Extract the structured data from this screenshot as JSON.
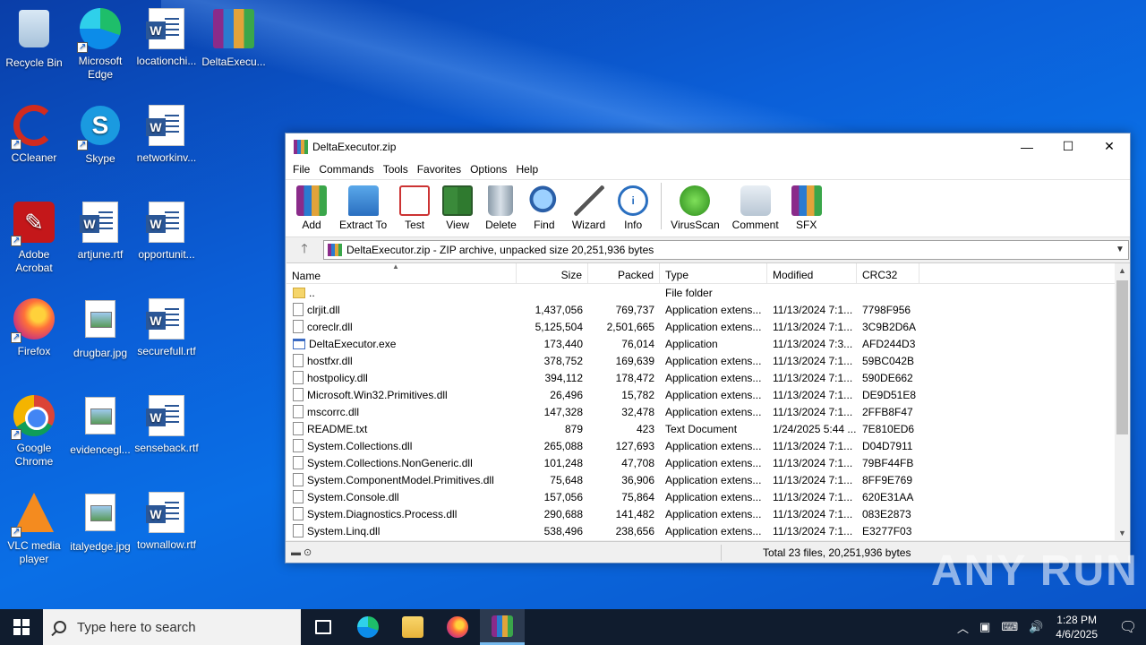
{
  "desktop": {
    "icons": [
      {
        "label": "Recycle Bin",
        "icon": "recycle-bin-icon"
      },
      {
        "label": "Microsoft Edge",
        "icon": "edge-icon"
      },
      {
        "label": "locationchi...",
        "icon": "word-doc-icon"
      },
      {
        "label": "DeltaExecu...",
        "icon": "winrar-icon"
      },
      {
        "label": "CCleaner",
        "icon": "ccleaner-icon"
      },
      {
        "label": "Skype",
        "icon": "skype-icon"
      },
      {
        "label": "networkinv...",
        "icon": "word-doc-icon"
      },
      {
        "label": "Adobe Acrobat",
        "icon": "acrobat-icon"
      },
      {
        "label": "artjune.rtf",
        "icon": "word-doc-icon"
      },
      {
        "label": "opportunit...",
        "icon": "word-doc-icon"
      },
      {
        "label": "Firefox",
        "icon": "firefox-icon"
      },
      {
        "label": "drugbar.jpg",
        "icon": "image-file-icon"
      },
      {
        "label": "securefull.rtf",
        "icon": "word-doc-icon"
      },
      {
        "label": "Google Chrome",
        "icon": "chrome-icon"
      },
      {
        "label": "evidencegl...",
        "icon": "image-file-icon"
      },
      {
        "label": "senseback.rtf",
        "icon": "word-doc-icon"
      },
      {
        "label": "VLC media player",
        "icon": "vlc-icon"
      },
      {
        "label": "italyedge.jpg",
        "icon": "image-file-icon"
      },
      {
        "label": "townallow.rtf",
        "icon": "word-doc-icon"
      }
    ]
  },
  "window": {
    "title": "DeltaExecutor.zip",
    "controls": {
      "minimize": "—",
      "maximize": "☐",
      "close": "✕"
    },
    "menu": [
      "File",
      "Commands",
      "Tools",
      "Favorites",
      "Options",
      "Help"
    ],
    "toolbar": [
      "Add",
      "Extract To",
      "Test",
      "View",
      "Delete",
      "Find",
      "Wizard",
      "Info",
      "VirusScan",
      "Comment",
      "SFX"
    ],
    "address": "DeltaExecutor.zip - ZIP archive, unpacked size 20,251,936 bytes",
    "columns": {
      "name": "Name",
      "size": "Size",
      "packed": "Packed",
      "type": "Type",
      "modified": "Modified",
      "crc": "CRC32"
    },
    "files": [
      {
        "name": "..",
        "size": "",
        "packed": "",
        "type": "File folder",
        "modified": "",
        "crc": "",
        "kind": "folder"
      },
      {
        "name": "clrjit.dll",
        "size": "1,437,056",
        "packed": "769,737",
        "type": "Application extens...",
        "modified": "11/13/2024 7:1...",
        "crc": "7798F956",
        "kind": "file"
      },
      {
        "name": "coreclr.dll",
        "size": "5,125,504",
        "packed": "2,501,665",
        "type": "Application extens...",
        "modified": "11/13/2024 7:1...",
        "crc": "3C9B2D6A",
        "kind": "file"
      },
      {
        "name": "DeltaExecutor.exe",
        "size": "173,440",
        "packed": "76,014",
        "type": "Application",
        "modified": "11/13/2024 7:3...",
        "crc": "AFD244D3",
        "kind": "exe"
      },
      {
        "name": "hostfxr.dll",
        "size": "378,752",
        "packed": "169,639",
        "type": "Application extens...",
        "modified": "11/13/2024 7:1...",
        "crc": "59BC042B",
        "kind": "file"
      },
      {
        "name": "hostpolicy.dll",
        "size": "394,112",
        "packed": "178,472",
        "type": "Application extens...",
        "modified": "11/13/2024 7:1...",
        "crc": "590DE662",
        "kind": "file"
      },
      {
        "name": "Microsoft.Win32.Primitives.dll",
        "size": "26,496",
        "packed": "15,782",
        "type": "Application extens...",
        "modified": "11/13/2024 7:1...",
        "crc": "DE9D51E8",
        "kind": "file"
      },
      {
        "name": "mscorrc.dll",
        "size": "147,328",
        "packed": "32,478",
        "type": "Application extens...",
        "modified": "11/13/2024 7:1...",
        "crc": "2FFB8F47",
        "kind": "file"
      },
      {
        "name": "README.txt",
        "size": "879",
        "packed": "423",
        "type": "Text Document",
        "modified": "1/24/2025 5:44 ...",
        "crc": "7E810ED6",
        "kind": "file"
      },
      {
        "name": "System.Collections.dll",
        "size": "265,088",
        "packed": "127,693",
        "type": "Application extens...",
        "modified": "11/13/2024 7:1...",
        "crc": "D04D7911",
        "kind": "file"
      },
      {
        "name": "System.Collections.NonGeneric.dll",
        "size": "101,248",
        "packed": "47,708",
        "type": "Application extens...",
        "modified": "11/13/2024 7:1...",
        "crc": "79BF44FB",
        "kind": "file"
      },
      {
        "name": "System.ComponentModel.Primitives.dll",
        "size": "75,648",
        "packed": "36,906",
        "type": "Application extens...",
        "modified": "11/13/2024 7:1...",
        "crc": "8FF9E769",
        "kind": "file"
      },
      {
        "name": "System.Console.dll",
        "size": "157,056",
        "packed": "75,864",
        "type": "Application extens...",
        "modified": "11/13/2024 7:1...",
        "crc": "620E31AA",
        "kind": "file"
      },
      {
        "name": "System.Diagnostics.Process.dll",
        "size": "290,688",
        "packed": "141,482",
        "type": "Application extens...",
        "modified": "11/13/2024 7:1...",
        "crc": "083E2873",
        "kind": "file"
      },
      {
        "name": "System.Linq.dll",
        "size": "538,496",
        "packed": "238,656",
        "type": "Application extens...",
        "modified": "11/13/2024 7:1...",
        "crc": "E3277F03",
        "kind": "file"
      }
    ],
    "status": "Total 23 files, 20,251,936 bytes"
  },
  "watermark": "ANY RUN",
  "taskbar": {
    "search_placeholder": "Type here to search",
    "time": "1:28 PM",
    "date": "4/6/2025"
  }
}
